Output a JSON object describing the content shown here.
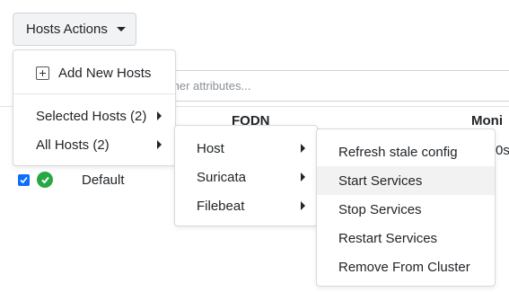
{
  "toolbar": {
    "hosts_actions_label": "Hosts Actions"
  },
  "search": {
    "placeholder_visible": "ther attributes..."
  },
  "table": {
    "col_fqdn": "FQDN",
    "col_monitor": "Moni",
    "row_name": "Default",
    "row_partial_right": "0s"
  },
  "menu_main": {
    "add_new_hosts": "Add New Hosts",
    "selected_hosts": "Selected Hosts (2)",
    "all_hosts": "All Hosts (2)"
  },
  "menu_services": {
    "host": "Host",
    "suricata": "Suricata",
    "filebeat": "Filebeat"
  },
  "menu_actions": {
    "refresh_stale_config": "Refresh stale config",
    "start_services": "Start Services",
    "stop_services": "Stop Services",
    "restart_services": "Restart Services",
    "remove_from_cluster": "Remove From Cluster"
  },
  "colors": {
    "accent": "#0d6efd",
    "status_ok": "#28a745",
    "highlight": "#f2f2f2"
  }
}
